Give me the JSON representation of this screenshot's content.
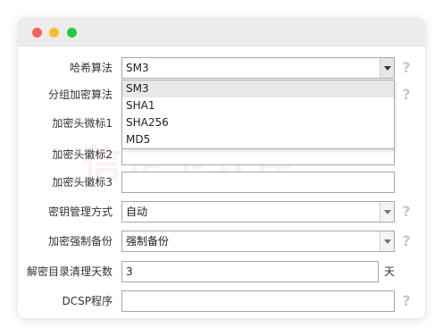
{
  "watermark": "信企卫软件",
  "form": {
    "hash_algo": {
      "label": "哈希算法",
      "value": "SM3",
      "options": [
        "SM3",
        "SHA1",
        "SHA256",
        "MD5"
      ],
      "selected": "SM3"
    },
    "block_cipher": {
      "label": "分组加密算法",
      "value": ""
    },
    "header_mark1": {
      "label": "加密头微标1",
      "value": ""
    },
    "header_mark2": {
      "label": "加密头徽标2",
      "value": ""
    },
    "header_mark3": {
      "label": "加密头徽标3",
      "value": ""
    },
    "key_mgmt": {
      "label": "密钥管理方式",
      "value": "自动"
    },
    "force_backup": {
      "label": "加密强制备份",
      "value": "强制备份"
    },
    "cleanup_days": {
      "label": "解密目录清理天数",
      "value": "3",
      "unit": "天"
    },
    "dcsp": {
      "label": "DCSP程序",
      "value": ""
    }
  },
  "help_symbol": "?",
  "colors": {
    "close": "#fe5f57",
    "minimize": "#febc2e",
    "zoom": "#28c840"
  }
}
